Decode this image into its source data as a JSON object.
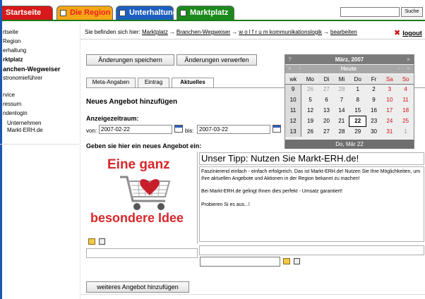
{
  "topnav": {
    "tabs": [
      {
        "label": "Startseite",
        "color": "#d71919"
      },
      {
        "label": "Die Region",
        "color": "#f5a616"
      },
      {
        "label": "Unterhaltung",
        "color": "#1d5fbf"
      },
      {
        "label": "Marktplatz",
        "color": "#1b8a1b"
      }
    ],
    "search_button": "Suche"
  },
  "sidebar": {
    "items": [
      {
        "label": "rtseite"
      },
      {
        "label": "Region"
      },
      {
        "label": "erhaltung"
      },
      {
        "label": "rktplatz"
      },
      {
        "label": "anchen-Wegweiser"
      },
      {
        "label": "stronomieführer"
      },
      {
        "label": "rvice"
      },
      {
        "label": "ressum"
      },
      {
        "label": "ndenlogin"
      },
      {
        "label": "Unternehmen"
      },
      {
        "label": "Markt-ERH.de"
      }
    ]
  },
  "breadcrumb": {
    "prefix": "Sie befinden sich hier:",
    "items": [
      "Marktplatz",
      "Branchen-Wegweiser",
      "w o l f r u m kommunikationslogik",
      "bearbeiten"
    ],
    "sep": "→"
  },
  "logout": {
    "label": "logout"
  },
  "actions": {
    "save": "Änderungen speichern",
    "discard": "Änderungen verwerfen"
  },
  "inner_tabs": [
    "Meta-Angaben",
    "Eintrag",
    "Aktuelles"
  ],
  "form": {
    "section_title": "Neues Angebot hinzufügen",
    "period_label": "Anzeigezeitraum:",
    "von_label": "von:",
    "von_value": "2007-02-22",
    "bis_label": "bis:",
    "bis_value": "2007-03-22",
    "offer_label": "Geben sie hier ein neues Angebot ein:"
  },
  "offer": {
    "image_title": "Eine ganz",
    "image_subtitle": "besondere Idee",
    "tip_title": "Unser Tipp: Nutzen Sie Markt-ERH.de!",
    "tip_paragraphs": [
      "Faszinierend einfach - einfach erfolgreich. Das ist Markt-ERH.de! Nutzen Sie Ihre Möglichkeiten, um Ihre aktuellen Angebote und Aktionen in der Region bekannt zu machen!",
      "Bei Markt-ERH.de gelingt Ihnen dies perfekt - Umsatz garantiert!",
      "Probieren Si es aus...!"
    ],
    "add_button": "weiteres Angebot hinzufügen"
  },
  "calendar": {
    "title": "März, 2007",
    "help": "?",
    "close": "×",
    "today_label": "Heute",
    "nav": {
      "prev_year": "«",
      "prev_month": "‹",
      "next_month": "›",
      "next_year": "»"
    },
    "headers": [
      "wk",
      "Mo",
      "Di",
      "Mi",
      "Do",
      "Fr",
      "Sa",
      "So"
    ],
    "weeks": [
      {
        "wk": "9",
        "days": [
          "26",
          "27",
          "28",
          "1",
          "2",
          "3",
          "4"
        ]
      },
      {
        "wk": "10",
        "days": [
          "5",
          "6",
          "7",
          "8",
          "9",
          "10",
          "11"
        ]
      },
      {
        "wk": "11",
        "days": [
          "12",
          "13",
          "14",
          "15",
          "16",
          "17",
          "18"
        ]
      },
      {
        "wk": "12",
        "days": [
          "19",
          "20",
          "21",
          "22",
          "23",
          "24",
          "25"
        ]
      },
      {
        "wk": "13",
        "days": [
          "26",
          "27",
          "28",
          "29",
          "30",
          "31",
          "1"
        ]
      }
    ],
    "selected_day": "22",
    "footer": "Do, Mär 22"
  }
}
